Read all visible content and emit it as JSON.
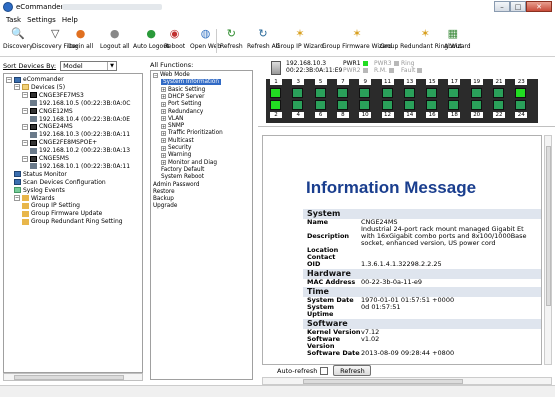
{
  "window": {
    "title": "eCommander",
    "min": "–",
    "max": "□",
    "close": "✕"
  },
  "menu": [
    "Task",
    "Settings",
    "Help"
  ],
  "toolbar": [
    {
      "label": "Discovery",
      "icon": "search-icon",
      "glyph": "🔍",
      "color": "#444"
    },
    {
      "label": "Discovery Filter",
      "icon": "filter-icon",
      "glyph": "▽",
      "color": "#444"
    },
    {
      "label": "Login all",
      "icon": "login-icon",
      "glyph": "●",
      "color": "#e07020"
    },
    {
      "label": "Logout all",
      "icon": "logout-icon",
      "glyph": "●",
      "color": "#888"
    },
    {
      "label": "Auto Logout",
      "icon": "user-icon",
      "glyph": "●",
      "color": "#2a9a3a"
    },
    {
      "label": "Reboot",
      "icon": "reboot-icon",
      "glyph": "◉",
      "color": "#c03030"
    },
    {
      "label": "Open Web",
      "icon": "globe-icon",
      "glyph": "◍",
      "color": "#3070c0"
    },
    {
      "label": "Refresh",
      "icon": "refresh-icon",
      "glyph": "↻",
      "color": "#2a8a2a"
    },
    {
      "label": "Refresh All",
      "icon": "refresh-all-icon",
      "glyph": "↻",
      "color": "#2a6a9a"
    },
    {
      "label": "Group IP Wizard",
      "icon": "wand-ip-icon",
      "glyph": "✶",
      "color": "#d8a020"
    },
    {
      "label": "Group Firmware Wizard",
      "icon": "wand-firmware-icon",
      "glyph": "✶",
      "color": "#d8a020"
    },
    {
      "label": "Group Redundant Ring Wizard",
      "icon": "wand-ring-icon",
      "glyph": "✶",
      "color": "#d8a020"
    },
    {
      "label": "About",
      "icon": "about-icon",
      "glyph": "▦",
      "color": "#3a8a3a"
    }
  ],
  "sort": {
    "label": "Sort Devices By:",
    "value": "Model"
  },
  "tree": [
    {
      "label": "eCommander",
      "kind": "pc",
      "exp": "−"
    },
    {
      "label": "Devices (5)",
      "kind": "folder",
      "exp": "−"
    },
    {
      "label": "CNGE3FE7MS3",
      "kind": "sw",
      "exp": "−"
    },
    {
      "label": "192.168.10.5 (00:22:3B:0A:0C",
      "kind": "lan",
      "exp": ""
    },
    {
      "label": "CNGE12MS",
      "kind": "sw",
      "exp": "−"
    },
    {
      "label": "192.168.10.4 (00:22:3B:0A:0E",
      "kind": "lan",
      "exp": ""
    },
    {
      "label": "CNGE24MS",
      "kind": "sw",
      "exp": "−"
    },
    {
      "label": "192.168.10.3 (00:22:3B:0A:11",
      "kind": "lan",
      "exp": ""
    },
    {
      "label": "CNGE2FE8MSPOE+",
      "kind": "sw",
      "exp": "−"
    },
    {
      "label": "192.168.10.2 (00:22:3B:0A:13",
      "kind": "lan",
      "exp": ""
    },
    {
      "label": "CNGE5MS",
      "kind": "sw",
      "exp": "−"
    },
    {
      "label": "192.168.10.1 (00:22:3B:0A:11",
      "kind": "lan",
      "exp": ""
    },
    {
      "label": "Status Monitor",
      "kind": "pc",
      "exp": ""
    },
    {
      "label": "Scan Devices Configuration",
      "kind": "pc",
      "exp": ""
    },
    {
      "label": "Syslog Events",
      "kind": "log",
      "exp": ""
    },
    {
      "label": "Wizards",
      "kind": "wiz",
      "exp": "−"
    },
    {
      "label": "Group IP Setting",
      "kind": "wiz",
      "exp": ""
    },
    {
      "label": "Group Firmware Update",
      "kind": "wiz",
      "exp": ""
    },
    {
      "label": "Group Redundant Ring Setting",
      "kind": "wiz",
      "exp": ""
    }
  ],
  "functions": {
    "label": "All Functions:",
    "items": [
      {
        "label": "Web Mode",
        "exp": "−",
        "sel": false
      },
      {
        "label": "System Information",
        "exp": "",
        "sel": true
      },
      {
        "label": "Basic Setting",
        "exp": "+",
        "sel": false
      },
      {
        "label": "DHCP Server",
        "exp": "+",
        "sel": false
      },
      {
        "label": "Port Setting",
        "exp": "+",
        "sel": false
      },
      {
        "label": "Redundancy",
        "exp": "+",
        "sel": false
      },
      {
        "label": "VLAN",
        "exp": "+",
        "sel": false
      },
      {
        "label": "SNMP",
        "exp": "+",
        "sel": false
      },
      {
        "label": "Traffic Prioritization",
        "exp": "+",
        "sel": false
      },
      {
        "label": "Multicast",
        "exp": "+",
        "sel": false
      },
      {
        "label": "Security",
        "exp": "+",
        "sel": false
      },
      {
        "label": "Warning",
        "exp": "+",
        "sel": false
      },
      {
        "label": "Monitor and Diag",
        "exp": "+",
        "sel": false
      },
      {
        "label": "Factory Default",
        "exp": "",
        "sel": false
      },
      {
        "label": "System Reboot",
        "exp": "",
        "sel": false
      },
      {
        "label": "Admin Password",
        "exp": "",
        "sel": false
      },
      {
        "label": "Restore",
        "exp": "",
        "sel": false
      },
      {
        "label": "Backup",
        "exp": "",
        "sel": false
      },
      {
        "label": "Upgrade",
        "exp": "",
        "sel": false
      }
    ]
  },
  "device": {
    "ip": "192.168.10.3",
    "mac": "00:22:3B:0A:11:E9",
    "pwr1": "PWR1",
    "pwr2": "PWR2",
    "pwr3": "PWR3",
    "ring": "Ring",
    "rm": "R.M.",
    "fault": "Fault",
    "top_ports": [
      "1",
      "3",
      "5",
      "7",
      "9",
      "11",
      "13",
      "15",
      "17",
      "19",
      "21",
      "23"
    ],
    "bottom_ports": [
      "2",
      "4",
      "6",
      "8",
      "10",
      "12",
      "14",
      "16",
      "18",
      "20",
      "22",
      "24"
    ],
    "port_up": {
      "top": [
        true,
        false,
        false,
        false,
        false,
        false,
        false,
        false,
        false,
        false,
        false,
        true
      ],
      "bottom": [
        true,
        false,
        false,
        false,
        false,
        false,
        false,
        false,
        false,
        false,
        false,
        false
      ]
    }
  },
  "info": {
    "title": "Information Message",
    "sections": [
      {
        "name": "System",
        "rows": [
          {
            "k": "Name",
            "v": [
              "CNGE24MS"
            ]
          },
          {
            "k": "Description",
            "v": [
              "Industrial 24-port rack mount managed Gigabit Et",
              "with 16xGigabit combo ports and 8x100/1000Base",
              "socket, enhanced version, US power cord"
            ]
          },
          {
            "k": "Location",
            "v": [
              ""
            ]
          },
          {
            "k": "Contact",
            "v": [
              ""
            ]
          },
          {
            "k": "OID",
            "v": [
              "1.3.6.1.4.1.32298.2.2.25"
            ]
          }
        ]
      },
      {
        "name": "Hardware",
        "rows": [
          {
            "k": "MAC Address",
            "v": [
              "00-22-3b-0a-11-e9"
            ]
          }
        ]
      },
      {
        "name": "Time",
        "rows": [
          {
            "k": "System Date",
            "v": [
              "1970-01-01 01:57:51 +0000"
            ]
          },
          {
            "k": "System Uptime",
            "v": [
              "0d 01:57:51"
            ]
          }
        ]
      },
      {
        "name": "Software",
        "rows": [
          {
            "k": "Kernel Version",
            "v": [
              "v7.12"
            ]
          },
          {
            "k": "Software Version",
            "v": [
              "v1.02"
            ]
          },
          {
            "k": "Software Date",
            "v": [
              "2013-08-09 09:28:44 +0800"
            ]
          }
        ]
      }
    ],
    "autorefresh": "Auto-refresh",
    "refresh": "Refresh"
  }
}
